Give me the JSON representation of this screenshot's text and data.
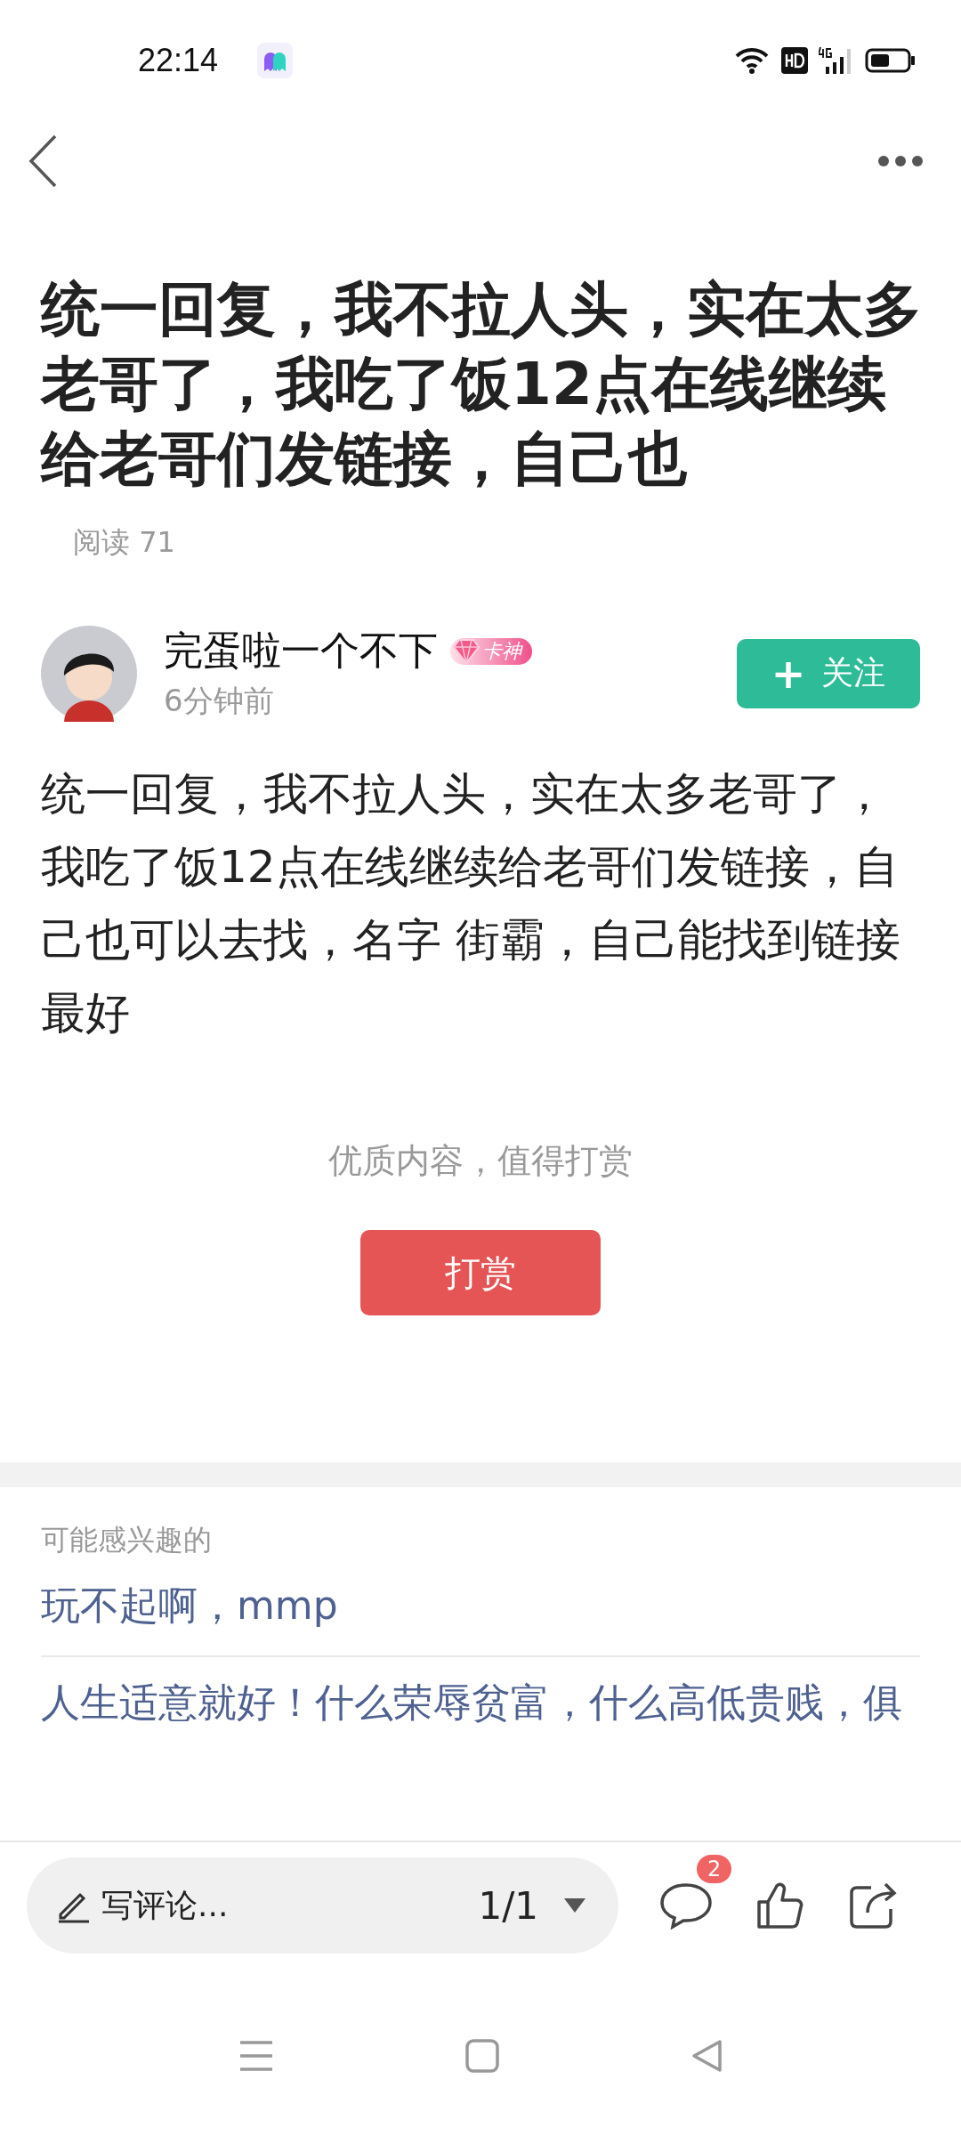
{
  "status_bar": {
    "time": "22:14"
  },
  "article": {
    "title": "统一回复，我不拉人头，实在太多老哥了，我吃了饭12点在线继续给老哥们发链接，自己也",
    "reads": "阅读 71"
  },
  "author": {
    "name": "完蛋啦一个不下",
    "badge": "卡神",
    "time": "6分钟前",
    "follow": {
      "icon": "+",
      "label": "关注",
      "followed": false
    }
  },
  "body": "统一回复，我不拉人头，实在太多老哥了，我吃了饭12点在线继续给老哥们发链接，自己也可以去找，名字  街霸，自己能找到链接最好",
  "reward": {
    "prompt": "优质内容，值得打赏",
    "button": "打赏"
  },
  "related": {
    "heading": "可能感兴趣的",
    "items": [
      "玩不起啊，mmp",
      "人生适意就好！什么荣辱贫富，什么高低贵贱，俱"
    ]
  },
  "bottom_bar": {
    "comment_placeholder": "写评论...",
    "page": "1/1",
    "comment_count": "2"
  }
}
